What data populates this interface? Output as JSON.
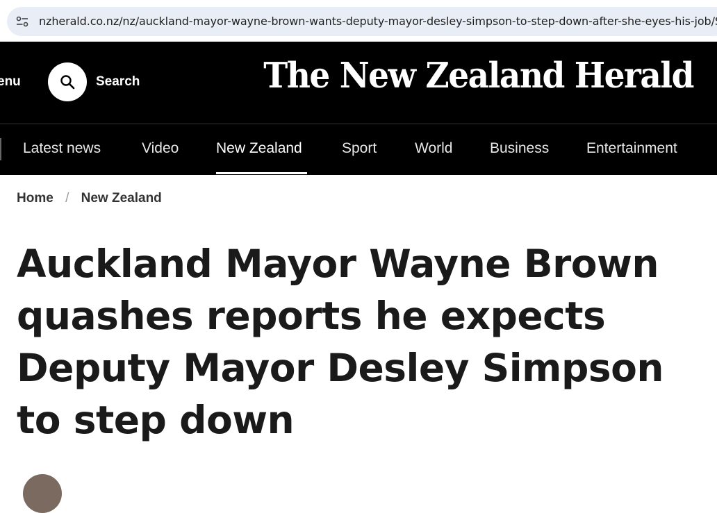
{
  "browser": {
    "url": "nzherald.co.nz/nz/auckland-mayor-wayne-brown-wants-deputy-mayor-desley-simpson-to-step-down-after-she-eyes-his-job/S"
  },
  "header": {
    "menu_label": "enu",
    "search_label": "Search",
    "logo_text": "The New Zealand Herald"
  },
  "nav": {
    "items": [
      {
        "label": "Latest news"
      },
      {
        "label": "Video"
      },
      {
        "label": "New Zealand"
      },
      {
        "label": "Sport"
      },
      {
        "label": "World"
      },
      {
        "label": "Business"
      },
      {
        "label": "Entertainment"
      }
    ],
    "active": "New Zealand"
  },
  "breadcrumb": {
    "home": "Home",
    "separator": "/",
    "section": "New Zealand"
  },
  "article": {
    "headline": "Auckland Mayor Wayne Brown quashes reports he expects Deputy Mayor Desley Simpson to step down"
  },
  "colors": {
    "header_bg": "#000000",
    "address_bar_bg": "#e9eef6",
    "headline_text": "#1a1a1a"
  }
}
